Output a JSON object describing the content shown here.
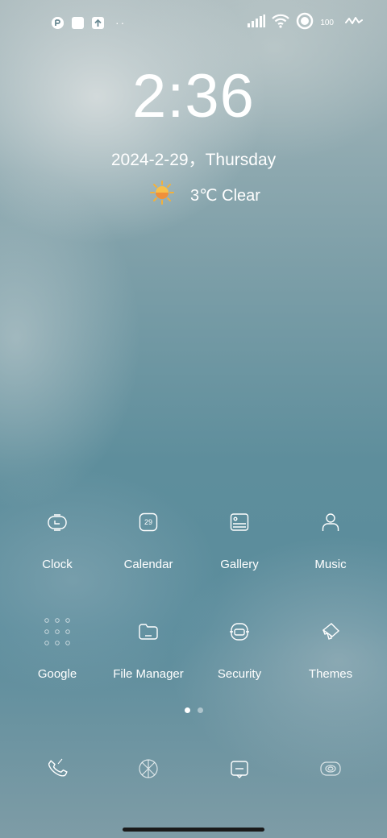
{
  "status": {
    "battery": "100"
  },
  "lockscreen": {
    "time": "2:36",
    "date": "2024-2-29，Thursday",
    "weather": {
      "icon": "sun-icon",
      "text": "3℃ Clear"
    }
  },
  "apps": [
    {
      "label": "Clock",
      "icon": "clock-icon"
    },
    {
      "label": "Calendar",
      "icon": "calendar-icon",
      "badge": "29"
    },
    {
      "label": "Gallery",
      "icon": "gallery-icon"
    },
    {
      "label": "Music",
      "icon": "person-icon"
    },
    {
      "label": "Google",
      "icon": "google-folder-icon"
    },
    {
      "label": "File Manager",
      "icon": "folder-icon"
    },
    {
      "label": "Security",
      "icon": "security-icon"
    },
    {
      "label": "Themes",
      "icon": "brush-icon"
    }
  ],
  "pager": {
    "pages": 2,
    "active": 0
  },
  "dock": [
    {
      "icon": "phone-icon"
    },
    {
      "icon": "browser-icon"
    },
    {
      "icon": "messages-icon"
    },
    {
      "icon": "camera-icon"
    }
  ]
}
